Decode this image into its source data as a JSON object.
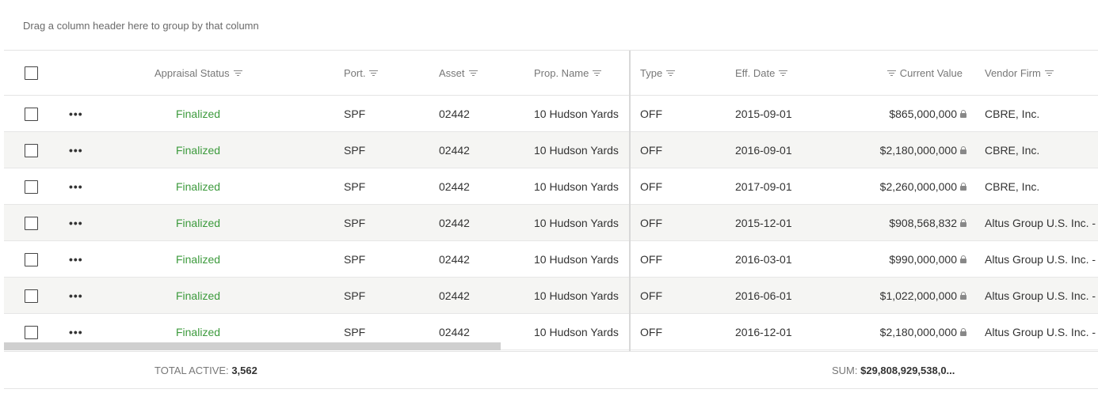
{
  "group_panel": {
    "hint": "Drag a column header here to group by that column"
  },
  "columns": {
    "appraisal_status": "Appraisal Status",
    "port": "Port.",
    "asset": "Asset",
    "prop_name": "Prop. Name",
    "type": "Type",
    "eff_date": "Eff. Date",
    "current_value": "Current Value",
    "vendor_firm": "Vendor Firm"
  },
  "rows": [
    {
      "status": "Finalized",
      "port": "SPF",
      "asset": "02442",
      "prop_name": "10 Hudson Yards",
      "type": "OFF",
      "eff_date": "2015-09-01",
      "current_value": "$865,000,000",
      "vendor": "CBRE, Inc."
    },
    {
      "status": "Finalized",
      "port": "SPF",
      "asset": "02442",
      "prop_name": "10 Hudson Yards",
      "type": "OFF",
      "eff_date": "2016-09-01",
      "current_value": "$2,180,000,000",
      "vendor": "CBRE, Inc."
    },
    {
      "status": "Finalized",
      "port": "SPF",
      "asset": "02442",
      "prop_name": "10 Hudson Yards",
      "type": "OFF",
      "eff_date": "2017-09-01",
      "current_value": "$2,260,000,000",
      "vendor": "CBRE, Inc."
    },
    {
      "status": "Finalized",
      "port": "SPF",
      "asset": "02442",
      "prop_name": "10 Hudson Yards",
      "type": "OFF",
      "eff_date": "2015-12-01",
      "current_value": "$908,568,832",
      "vendor": "Altus Group U.S. Inc. - N"
    },
    {
      "status": "Finalized",
      "port": "SPF",
      "asset": "02442",
      "prop_name": "10 Hudson Yards",
      "type": "OFF",
      "eff_date": "2016-03-01",
      "current_value": "$990,000,000",
      "vendor": "Altus Group U.S. Inc. - N"
    },
    {
      "status": "Finalized",
      "port": "SPF",
      "asset": "02442",
      "prop_name": "10 Hudson Yards",
      "type": "OFF",
      "eff_date": "2016-06-01",
      "current_value": "$1,022,000,000",
      "vendor": "Altus Group U.S. Inc. - N"
    },
    {
      "status": "Finalized",
      "port": "SPF",
      "asset": "02442",
      "prop_name": "10 Hudson Yards",
      "type": "OFF",
      "eff_date": "2016-12-01",
      "current_value": "$2,180,000,000",
      "vendor": "Altus Group U.S. Inc. - N"
    }
  ],
  "row_actions_label": "•••",
  "footer": {
    "total_label": "TOTAL ACTIVE:",
    "total_value": "3,562",
    "sum_label": "SUM:",
    "sum_value": "$29,808,929,538,0..."
  },
  "colors": {
    "status_finalized": "#3c9a3c"
  }
}
